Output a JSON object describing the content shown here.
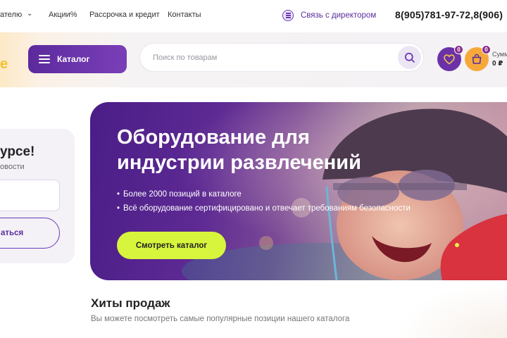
{
  "topbar": {
    "nav": [
      {
        "label": "ателю"
      },
      {
        "label": "Акции%"
      },
      {
        "label": "Рассрочка и кредит"
      },
      {
        "label": "Контакты"
      }
    ],
    "contact_label": "Связь с директором",
    "phones": "8(905)781-97-72,8(906)"
  },
  "header": {
    "logo_fragment": "e",
    "catalog_label": "Каталог",
    "search_placeholder": "Поиск по товарам",
    "favorites_count": "0",
    "cart_count": "0",
    "sum_label": "Сумм",
    "sum_value": "0 ₽"
  },
  "side": {
    "title": "урсе!",
    "subtitle": "овости",
    "button_label": "аться"
  },
  "hero": {
    "title": "Оборудование для индустрии развлечений",
    "bullets": [
      "Более 2000 позиций в каталоге",
      "Всё оборудование сертифицировано и отвечает требованиям безопасности"
    ],
    "button_label": "Смотреть каталог"
  },
  "hits": {
    "title": "Хиты продаж",
    "subtitle": "Вы можете посмотреть самые популярные позиции нашего каталога"
  },
  "colors": {
    "brand_purple": "#5c2a9d",
    "accent_lime": "#d7f53d",
    "accent_orange": "#f6a93a"
  }
}
